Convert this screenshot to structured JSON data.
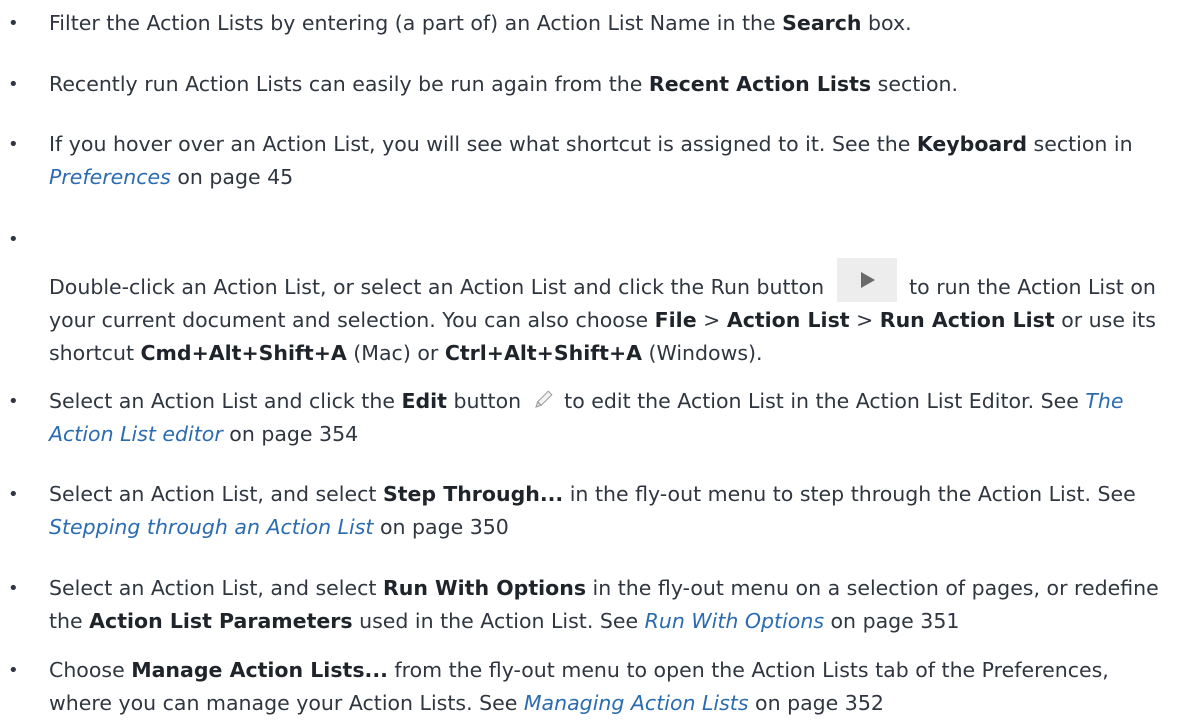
{
  "bullets": [
    {
      "t1": "Filter the Action Lists by entering (a part of) an Action List Name in the ",
      "b1": "Search",
      "t2": " box."
    },
    {
      "t1": "Recently run Action Lists can easily be run again from the ",
      "b1": "Recent Action Lists",
      "t2": " section."
    },
    {
      "t1": "If you hover over an Action List, you will see what shortcut is assigned to it. See the ",
      "b1": "Keyboard",
      "t2": " section in ",
      "link": "Preferences",
      "t3": " on page 45"
    },
    {
      "t1": "Double-click an Action List, or select an Action List and click the Run button ",
      "t2": " to run the Action List on your current document and selection. You can also choose ",
      "b1": "File",
      "t3": " > ",
      "b2": "Action List",
      "t4": " > ",
      "b3": "Run Action List",
      "t5": " or use its shortcut ",
      "b4": "Cmd+Alt+Shift+A",
      "t6": " (Mac) or ",
      "b5": "Ctrl+Alt+Shift+A",
      "t7": " (Windows)."
    },
    {
      "t1": "Select an Action List and click the ",
      "b1": "Edit",
      "t2": " button ",
      "t3": " to edit the Action List in the Action List Editor. See ",
      "link": "The Action List editor",
      "t4": " on page 354"
    },
    {
      "t1": "Select an Action List, and select ",
      "b1": "Step Through...",
      "t2": " in the fly-out menu to step through the Action List. See ",
      "link": "Stepping through an Action List",
      "t3": " on page 350"
    },
    {
      "t1": "Select an Action List, and select ",
      "b1": "Run With Options",
      "t2": " in the fly-out menu on a selection of pages, or redefine the ",
      "b2": "Action List Parameters",
      "t3": " used in the Action List. See ",
      "link": "Run With Options",
      "t4": " on page 351"
    },
    {
      "t1": "Choose ",
      "b1": "Manage Action Lists...",
      "t2": " from the fly-out menu to open the Action Lists tab of the Preferences, where you can manage your Action Lists. See ",
      "link": "Managing Action Lists",
      "t3": " on page 352"
    }
  ],
  "icons": {
    "run": "play-icon",
    "edit": "pencil-icon"
  },
  "colors": {
    "text": "#2f3640",
    "link": "#2b6cb0",
    "run_button_bg": "#ededed"
  }
}
